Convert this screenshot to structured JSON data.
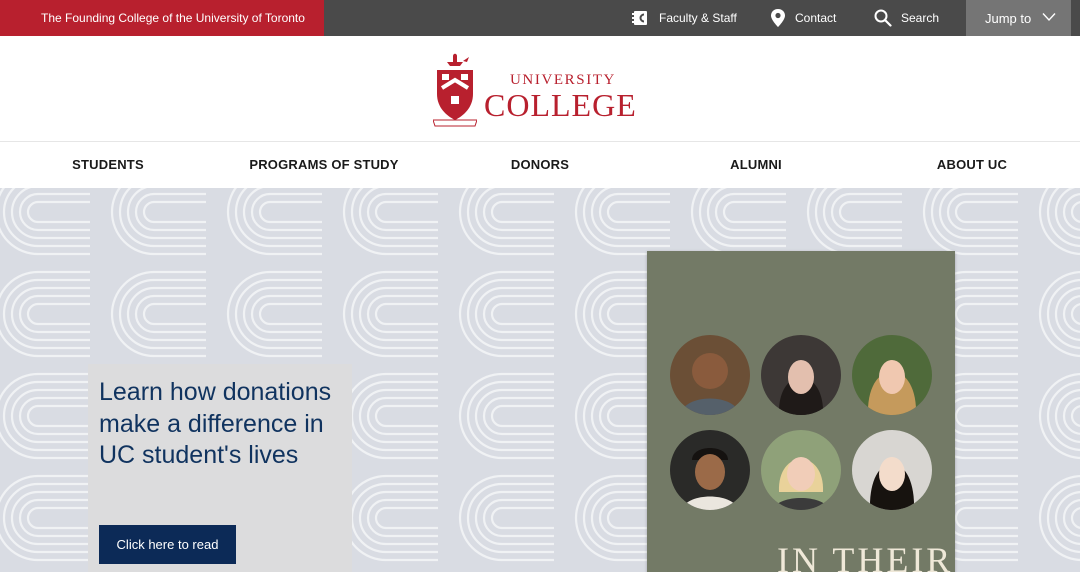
{
  "utility_bar": {
    "founding_text": "The Founding College of the University of Toronto",
    "links": {
      "faculty": "Faculty & Staff",
      "contact": "Contact",
      "search": "Search"
    },
    "jump_to": "Jump to"
  },
  "logo": {
    "line1": "UNIVERSITY",
    "line2": "COLLEGE",
    "icon": "crest-icon"
  },
  "main_nav": {
    "items": [
      "STUDENTS",
      "PROGRAMS OF STUDY",
      "DONORS",
      "ALUMNI",
      "ABOUT UC"
    ]
  },
  "hero": {
    "promo_title": "Learn how donations make a difference in UC student's lives",
    "promo_button": "Click here to read",
    "cover_text": "IN THEIR"
  },
  "colors": {
    "brand_red": "#b8202e",
    "navy": "#0c2a57",
    "utility_bg": "#4a4a4a",
    "hero_bg": "#d9dce3",
    "cover_bg": "#737a66"
  }
}
